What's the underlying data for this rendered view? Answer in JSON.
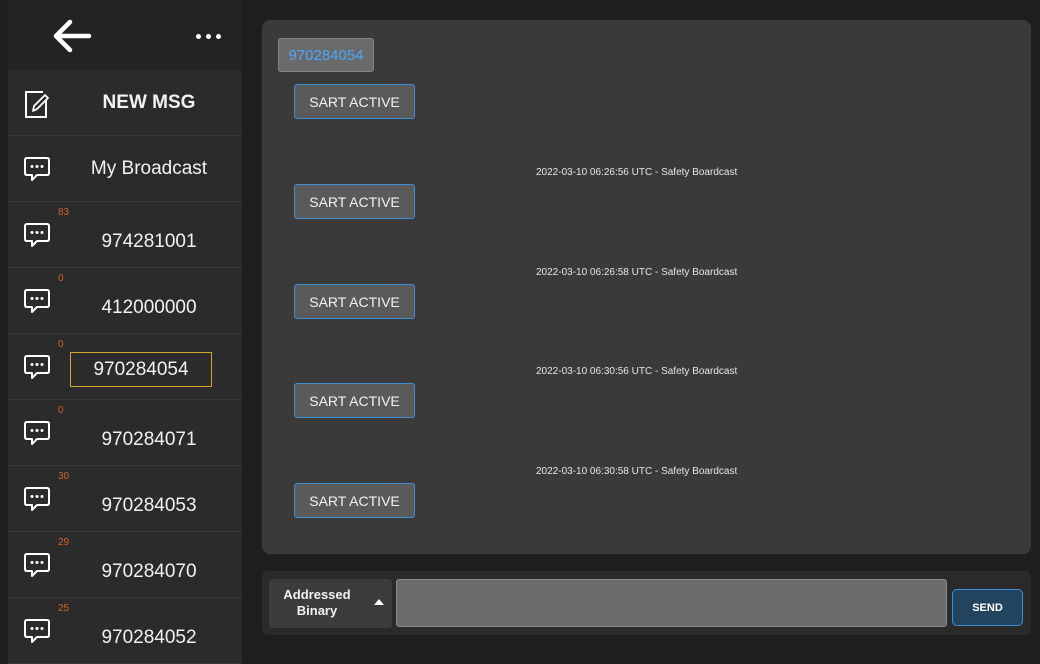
{
  "sidebar": {
    "new_msg_label": "NEW MSG",
    "items": [
      {
        "label": "My Broadcast",
        "count": ""
      },
      {
        "label": "974281001",
        "count": "83"
      },
      {
        "label": "412000000",
        "count": "0"
      },
      {
        "label": "970284054",
        "count": "0",
        "selected": true
      },
      {
        "label": "970284071",
        "count": "0"
      },
      {
        "label": "970284053",
        "count": "30"
      },
      {
        "label": "970284070",
        "count": "29"
      },
      {
        "label": "970284052",
        "count": "25"
      }
    ]
  },
  "conversation": {
    "contact": "970284054",
    "messages": [
      {
        "text": "SART ACTIVE",
        "timestamp": "2022-03-10 06:26:56 UTC - Safety Boardcast"
      },
      {
        "text": "SART ACTIVE",
        "timestamp": "2022-03-10 06:26:58 UTC - Safety Boardcast"
      },
      {
        "text": "SART ACTIVE",
        "timestamp": "2022-03-10 06:30:56 UTC - Safety Boardcast"
      },
      {
        "text": "SART ACTIVE",
        "timestamp": "2022-03-10 06:30:58 UTC - Safety Boardcast"
      },
      {
        "text": "SART ACTIVE",
        "timestamp": ""
      }
    ]
  },
  "compose": {
    "type_line1": "Addressed",
    "type_line2": "Binary",
    "input_value": "",
    "send_label": "SEND"
  },
  "colors": {
    "accent_blue": "#3c8ed8",
    "contact_blue": "#4da6ff",
    "count_orange": "#d4622b",
    "selected_outline": "#d4a52b"
  },
  "icons": {
    "back": "arrow-left-icon",
    "more": "more-dots-icon",
    "new_msg": "compose-icon",
    "chat": "chat-bubble-icon"
  }
}
